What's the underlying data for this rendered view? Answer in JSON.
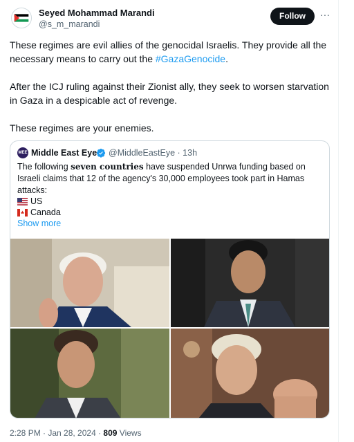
{
  "author": {
    "name": "Seyed Mohammad Marandi",
    "handle": "@s_m_marandi"
  },
  "follow_label": "Follow",
  "more_label": "···",
  "tweet": {
    "p1_before": "These regimes are evil allies of the genocidal Israelis. They provide all the necessary means to carry out the ",
    "hashtag": "#GazaGenocide",
    "p1_after": ".",
    "p2": "After the ICJ ruling against their Zionist ally, they seek to worsen starvation in Gaza in a despicable act of revenge.",
    "p3": "These regimes are your enemies."
  },
  "quote": {
    "avatar_text": "MEE",
    "name": "Middle East Eye",
    "handle_time": "@MiddleEastEye · 13h",
    "text_before": "The following ",
    "text_bold": "seven countries",
    "text_after": " have suspended Unrwa funding based on Israeli claims that 12 of the agency's 30,000 employees took part in Hamas attacks:",
    "countries": [
      "US",
      "Canada"
    ],
    "show_more": "Show more"
  },
  "footer": {
    "time_date": "2:28 PM · Jan 28, 2024 · ",
    "views_count": "809",
    "views_label": " Views"
  },
  "colors": {
    "link": "#1d9bf0",
    "text": "#0f1419",
    "secondary": "#536471",
    "follow_bg": "#0f1419",
    "verified": "#1d9bf0"
  },
  "icons": [
    "palestine-flag-avatar",
    "verified-badge-icon",
    "us-flag-icon",
    "canada-flag-icon",
    "more-icon"
  ]
}
